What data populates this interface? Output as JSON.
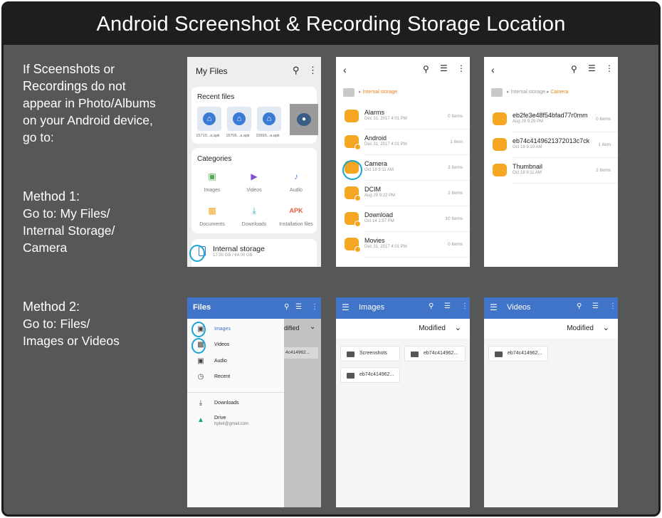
{
  "title": "Android Screenshot & Recording Storage Location",
  "intro": {
    "line1_pre": "If ",
    "line1_bold": "Sceenshots",
    "line1_post": " or",
    "line2_bold": "Recordings",
    "line2_post": " do not",
    "line3": "appear in Photo/Albums",
    "line4": "on your Android device,",
    "line5": "go to:"
  },
  "method1": {
    "heading": "Method 1:",
    "line1": "Go to: My Files/",
    "line2": "Internal Storage/",
    "line3": "Camera"
  },
  "method2": {
    "heading": "Method 2:",
    "line1": "Go to: Files/",
    "line2": "Images or Videos"
  },
  "myfiles": {
    "title": "My Files",
    "recent_title": "Recent files",
    "recent": [
      "15710...a.apk",
      "15706...a.apk",
      "15693...a.apk"
    ],
    "categories_title": "Categories",
    "categories": [
      "Images",
      "Videos",
      "Audio",
      "Documents",
      "Downloads",
      "Installation files"
    ],
    "apk_label": "APK",
    "storage_name": "Internal storage",
    "storage_size": "17.55 GB / 64.00 GB"
  },
  "internal": {
    "crumb": "Internal storage",
    "folders": [
      {
        "name": "Alarms",
        "date": "Dec 31, 2017 4:01 PM",
        "count": "0 items"
      },
      {
        "name": "Android",
        "date": "Dec 31, 2017 4:01 PM",
        "count": "1 item"
      },
      {
        "name": "Camera",
        "date": "Oct 18 9:11 AM",
        "count": "3 items"
      },
      {
        "name": "DCIM",
        "date": "Aug 29 9:22 PM",
        "count": "2 items"
      },
      {
        "name": "Download",
        "date": "Oct 14 1:57 PM",
        "count": "10 items"
      },
      {
        "name": "Movies",
        "date": "Dec 31, 2017 4:01 PM",
        "count": "0 items"
      }
    ]
  },
  "camera": {
    "crumb_root": "Internal storage",
    "crumb_current": "Camera",
    "folders": [
      {
        "name": "eb2fe3e48f54bfad77r0mm",
        "date": "Aug 29 9:29 PM",
        "count": "0 items"
      },
      {
        "name": "eb74c4149621372013c7ck",
        "date": "Oct 18 9:10 AM",
        "count": "1 item"
      },
      {
        "name": "Thumbnail",
        "date": "Oct 18 9:11 AM",
        "count": "2 items"
      }
    ]
  },
  "files_drawer": {
    "title": "Files",
    "items": [
      "Images",
      "Videos",
      "Audio",
      "Recent"
    ],
    "downloads": "Downloads",
    "drive": "Drive",
    "account": "hpfeit@gmail.com",
    "behind_sort": "dified",
    "behind_chip": "4c414962..."
  },
  "images_screen": {
    "title": "Images",
    "sort": "Modified",
    "folders": [
      "Screenshots",
      "eb74c414962...",
      "eb74c414962..."
    ]
  },
  "videos_screen": {
    "title": "Videos",
    "sort": "Modified",
    "folders": [
      "eb74c414962..."
    ]
  }
}
